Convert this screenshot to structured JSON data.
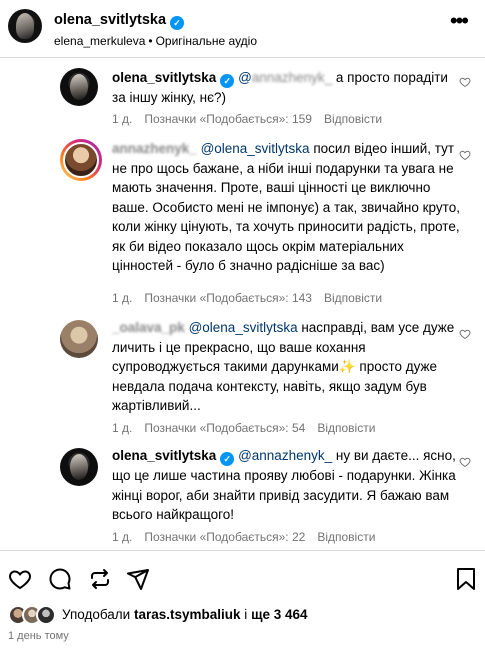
{
  "header": {
    "username": "olena_svitlytska",
    "audio_author": "elena_merkuleva",
    "audio_label": "Оригінальне аудіо",
    "more_icon": "more-horizontal-icon"
  },
  "comments": [
    {
      "username": "olena_svitlytska",
      "verified": true,
      "mention": "@",
      "text": " а просто порадіти за іншу жінку, нє?)",
      "time": "1 д.",
      "likes": "Позначки «Подобається»: 159",
      "reply": "Відповісти"
    },
    {
      "username": "annazhenyk_",
      "mention": "@olena_svitlytska",
      "text": " посил відео інший, тут не про щось бажане, а ніби інші подарунки та увага не мають значення. Проте, ваші цінності це виключно ваше. Особисто мені не імпонує) а так, звичайно круто, коли жінку цінують, та хочуть приносити радість, проте, як би відео показало щось окрім матеріальних цінностей - було б значно радісніше за вас)",
      "time": "1 д.",
      "likes": "Позначки «Подобається»: 143",
      "reply": "Відповісти"
    },
    {
      "username": "_oalava_pk",
      "mention": "@olena_svitlytska",
      "text": " насправді, вам усе дуже личить і це прекрасно, що ваше кохання супроводжується такими дарунками✨ просто дуже невдала подача контексту, навіть, якщо задум був жартівливий...",
      "time": "1 д.",
      "likes": "Позначки «Подобається»: 54",
      "reply": "Відповісти"
    },
    {
      "username": "olena_svitlytska",
      "verified": true,
      "mention": "@annazhenyk_",
      "text": " ну ви даєте... ясно, що це лише частина прояву любові - подарунки. Жінка жінці ворог, аби знайти привід засудити. Я бажаю вам всього найкращого!",
      "time": "1 д.",
      "likes": "Позначки «Подобається»: 22",
      "reply": "Відповісти"
    }
  ],
  "likes_bar": {
    "prefix": "Уподобали ",
    "user": "taras.tsymbaliuk",
    "mid": " і ",
    "count": "ще 3 464"
  },
  "time_ago": "1 день тому",
  "colors": {
    "link": "#00376b",
    "secondary_text": "#737373",
    "verified": "#0095f6",
    "divider": "#dbdbdb"
  }
}
